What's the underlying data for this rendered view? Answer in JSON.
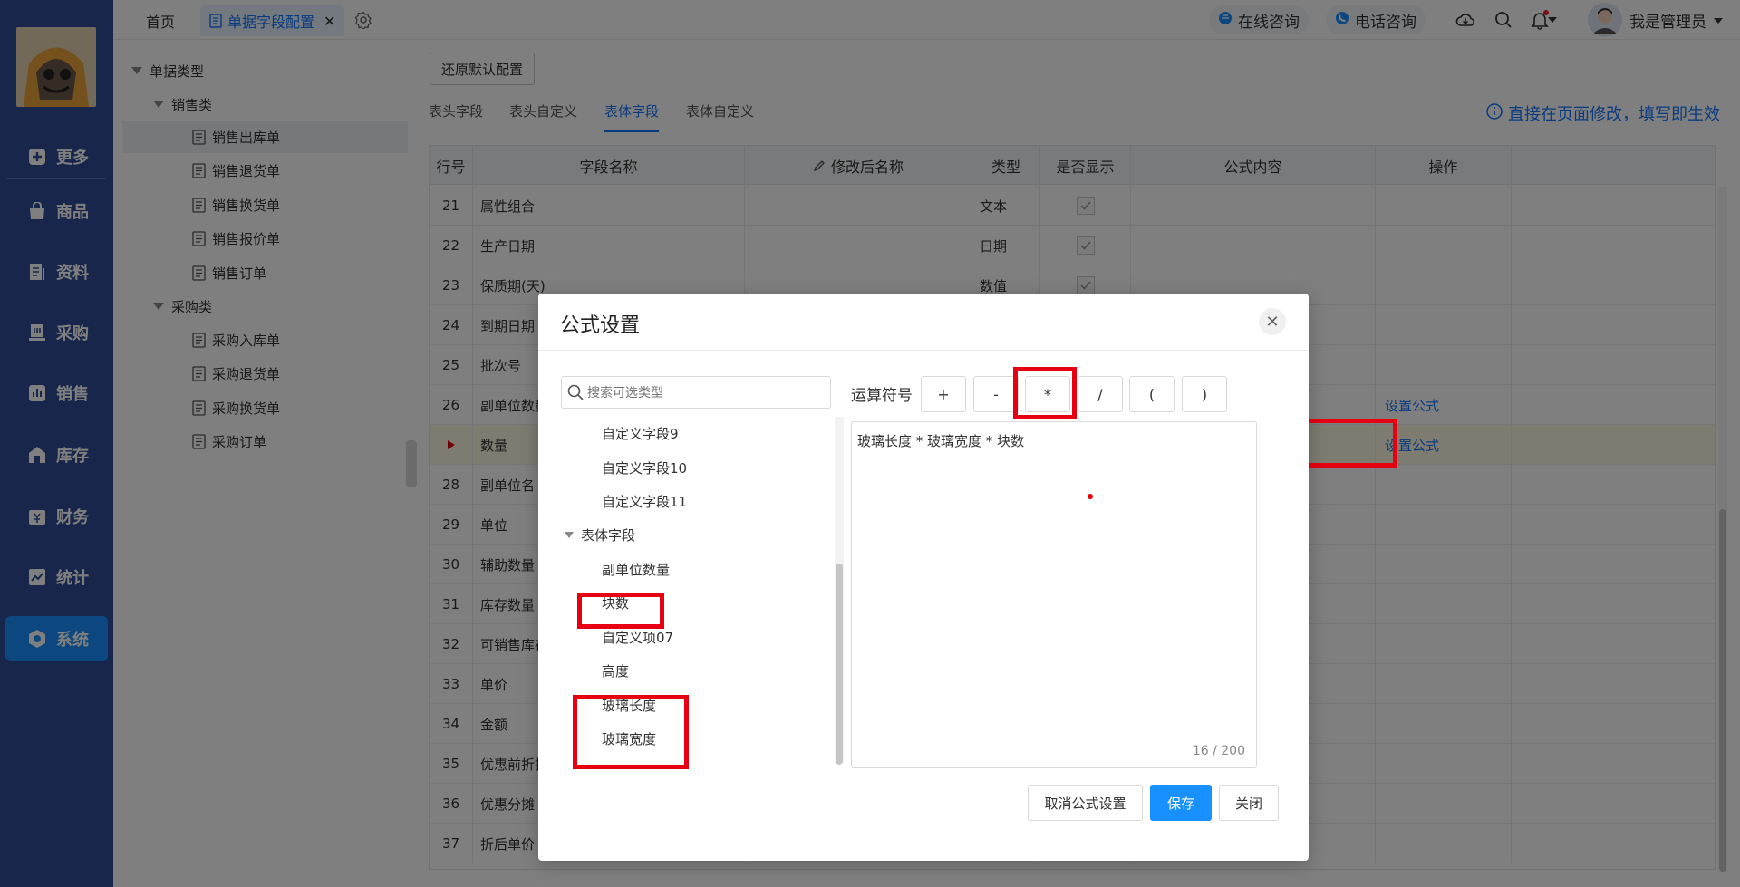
{
  "nav": {
    "items": [
      {
        "label": "更多",
        "icon": "plus-square-icon"
      },
      {
        "label": "商品",
        "icon": "bag-icon"
      },
      {
        "label": "资料",
        "icon": "document-icon"
      },
      {
        "label": "采购",
        "icon": "cart-icon"
      },
      {
        "label": "销售",
        "icon": "bar-chart-icon"
      },
      {
        "label": "库存",
        "icon": "warehouse-icon"
      },
      {
        "label": "财务",
        "icon": "yen-icon"
      },
      {
        "label": "统计",
        "icon": "trend-chart-icon"
      },
      {
        "label": "系统",
        "icon": "hexagon-settings-icon",
        "active": true
      }
    ]
  },
  "topbar": {
    "tab_home": "首页",
    "tab_active": "单据字段配置",
    "online_consult": "在线咨询",
    "phone_consult": "电话咨询",
    "username": "我是管理员"
  },
  "tree": {
    "root": "单据类型",
    "sales_group": "销售类",
    "sales_items": [
      "销售出库单",
      "销售退货单",
      "销售换货单",
      "销售报价单",
      "销售订单"
    ],
    "purchase_group": "采购类",
    "purchase_items": [
      "采购入库单",
      "采购退货单",
      "采购换货单",
      "采购订单"
    ]
  },
  "main": {
    "restore_button": "还原默认配置",
    "subtabs": [
      "表头字段",
      "表头自定义",
      "表体字段",
      "表体自定义"
    ],
    "active_subtab": "表体字段",
    "hint": "直接在页面修改，填写即生效"
  },
  "table": {
    "headers": {
      "row_no": "行号",
      "field_name": "字段名称",
      "renamed": "修改后名称",
      "type": "类型",
      "visible": "是否显示",
      "formula": "公式内容",
      "action": "操作"
    },
    "rows": [
      {
        "no": "21",
        "name": "属性组合",
        "type": "文本",
        "checked": true,
        "action": ""
      },
      {
        "no": "22",
        "name": "生产日期",
        "type": "日期",
        "checked": true,
        "action": ""
      },
      {
        "no": "23",
        "name": "保质期(天)",
        "type": "数值",
        "checked": true,
        "action": ""
      },
      {
        "no": "24",
        "name": "到期日期",
        "type": "",
        "checked": false,
        "action": ""
      },
      {
        "no": "25",
        "name": "批次号",
        "type": "",
        "checked": false,
        "action": ""
      },
      {
        "no": "26",
        "name": "副单位数量",
        "type": "",
        "checked": false,
        "action": "设置公式"
      },
      {
        "no": "",
        "name": "数量",
        "type": "",
        "checked": false,
        "action": "设置公式",
        "current": true
      },
      {
        "no": "28",
        "name": "副单位名",
        "type": "",
        "checked": false,
        "action": ""
      },
      {
        "no": "29",
        "name": "单位",
        "type": "",
        "checked": false,
        "action": ""
      },
      {
        "no": "30",
        "name": "辅助数量",
        "type": "",
        "checked": false,
        "action": ""
      },
      {
        "no": "31",
        "name": "库存数量",
        "type": "",
        "checked": false,
        "action": ""
      },
      {
        "no": "32",
        "name": "可销售库存",
        "type": "",
        "checked": false,
        "action": ""
      },
      {
        "no": "33",
        "name": "单价",
        "type": "",
        "checked": false,
        "action": ""
      },
      {
        "no": "34",
        "name": "金额",
        "type": "",
        "checked": false,
        "action": ""
      },
      {
        "no": "35",
        "name": "优惠前折扣",
        "type": "",
        "checked": false,
        "action": ""
      },
      {
        "no": "36",
        "name": "优惠分摊",
        "type": "",
        "checked": false,
        "action": ""
      },
      {
        "no": "37",
        "name": "折后单价",
        "type": "",
        "checked": false,
        "action": ""
      }
    ]
  },
  "modal": {
    "title": "公式设置",
    "search_placeholder": "搜索可选类型",
    "custom_fields": [
      "自定义字段9",
      "自定义字段10",
      "自定义字段11"
    ],
    "body_group": "表体字段",
    "body_fields": [
      "副单位数量",
      "块数",
      "自定义项07",
      "高度",
      "玻璃长度",
      "玻璃宽度"
    ],
    "operator_label": "运算符号",
    "operators": [
      "+",
      "-",
      "*",
      "/",
      "(",
      ")"
    ],
    "formula": "玻璃长度 * 玻璃宽度 * 块数",
    "counter": "16 / 200",
    "cancel_formula": "取消公式设置",
    "save": "保存",
    "close": "关闭"
  }
}
